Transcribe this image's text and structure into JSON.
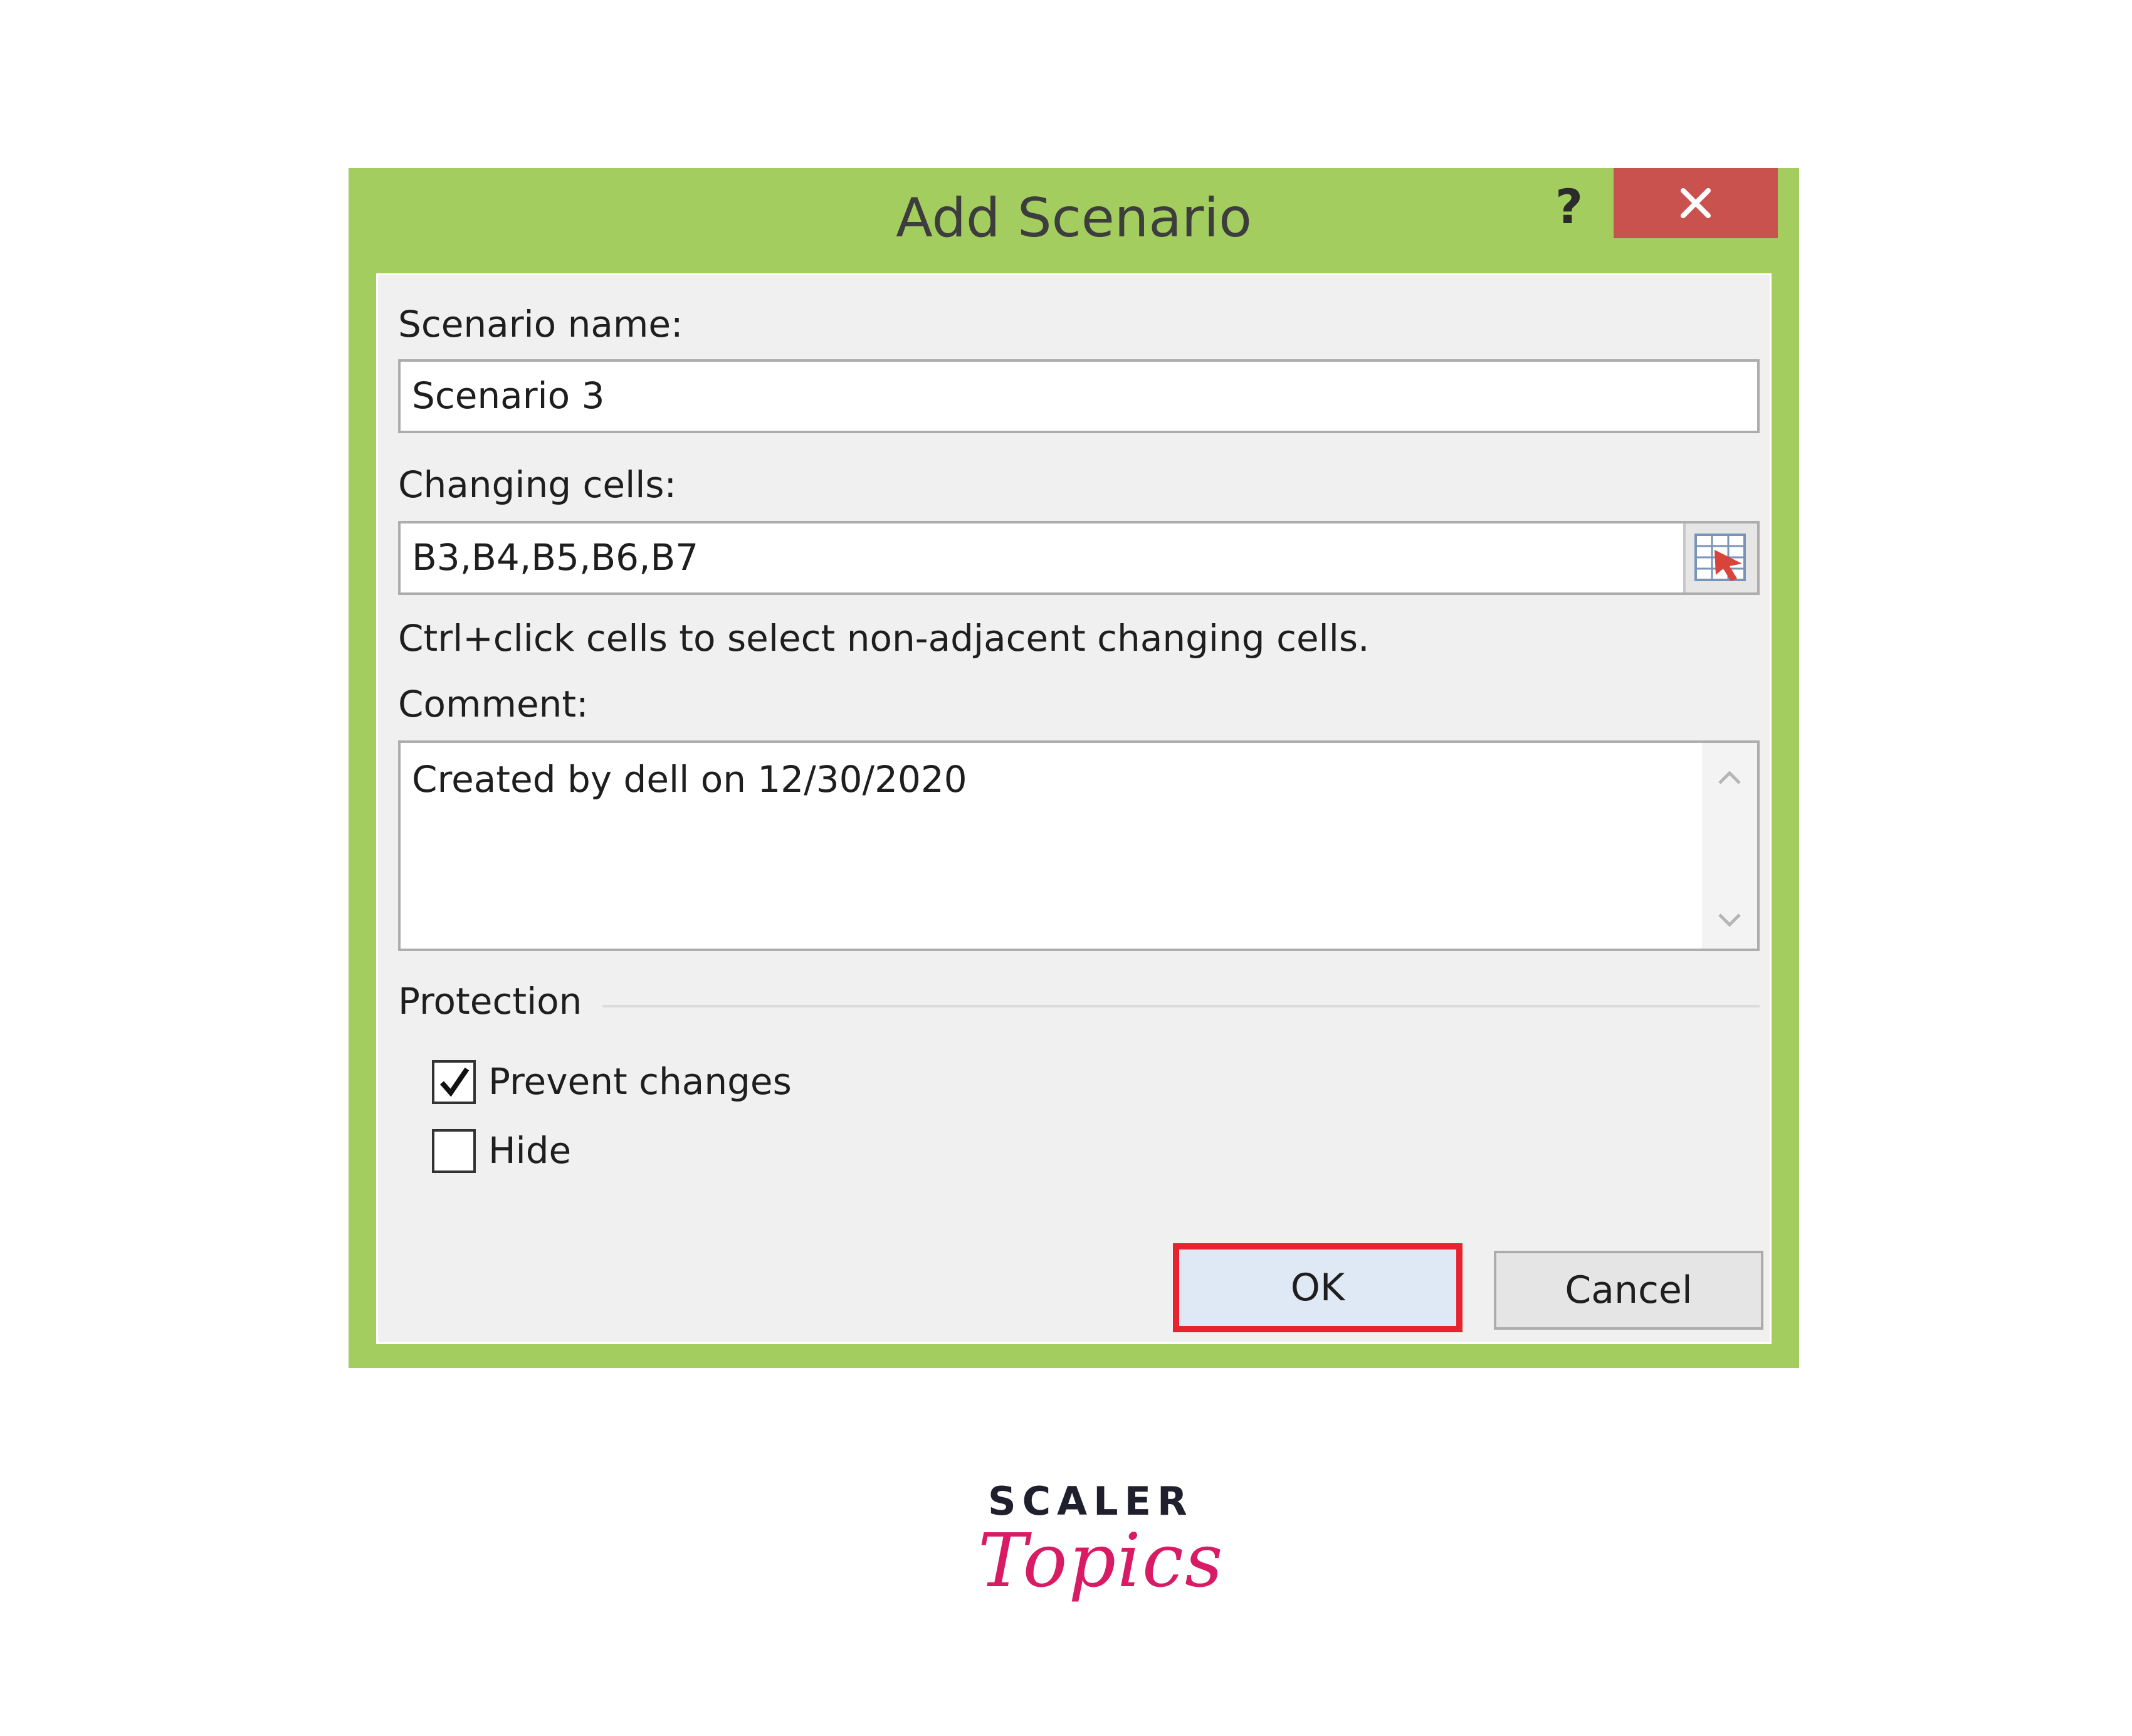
{
  "dialog": {
    "title": "Add Scenario",
    "help_label": "?",
    "frame_color": "#a4cd5f",
    "close_color": "#c9524e"
  },
  "scenario_name": {
    "label": "Scenario name:",
    "value": "Scenario 3"
  },
  "changing_cells": {
    "label": "Changing cells:",
    "value": "B3,B4,B5,B6,B7",
    "hint": "Ctrl+click cells to select non-adjacent changing cells."
  },
  "comment": {
    "label": "Comment:",
    "value": "Created by dell on 12/30/2020"
  },
  "protection": {
    "label": "Protection",
    "prevent_changes": {
      "label": "Prevent changes",
      "checked": true
    },
    "hide": {
      "label": "Hide",
      "checked": false
    }
  },
  "buttons": {
    "ok": "OK",
    "cancel": "Cancel",
    "ok_highlight_color": "#e8222e"
  },
  "brand": {
    "line1": "SCALER",
    "line2": "Topics",
    "accent": "#d81b64"
  }
}
